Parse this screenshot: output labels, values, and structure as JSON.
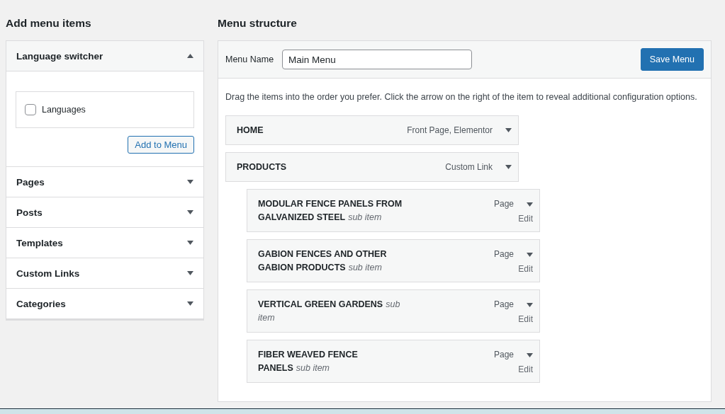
{
  "add_menu_items": {
    "heading": "Add menu items",
    "sections": [
      {
        "title": "Language switcher",
        "expanded": true,
        "options": [
          {
            "label": "Languages",
            "checked": false
          }
        ],
        "button": "Add to Menu"
      },
      {
        "title": "Pages",
        "expanded": false
      },
      {
        "title": "Posts",
        "expanded": false
      },
      {
        "title": "Templates",
        "expanded": false
      },
      {
        "title": "Custom Links",
        "expanded": false
      },
      {
        "title": "Categories",
        "expanded": false
      }
    ]
  },
  "menu_structure": {
    "heading": "Menu structure",
    "menu_name_label": "Menu Name",
    "menu_name_value": "Main Menu",
    "save_button": "Save Menu",
    "instructions": "Drag the items into the order you prefer. Click the arrow on the right of the item to reveal additional configuration options.",
    "items": [
      {
        "title": "HOME",
        "type": "Front Page, Elementor"
      },
      {
        "title": "PRODUCTS",
        "type": "Custom Link",
        "children": [
          {
            "title": "MODULAR FENCE PANELS FROM GALVANIZED STEEL",
            "note": "sub item",
            "type": "Page",
            "edit": "Edit"
          },
          {
            "title": "GABION FENCES AND OTHER GABION PRODUCTS",
            "note": "sub item",
            "type": "Page",
            "edit": "Edit"
          },
          {
            "title": "VERTICAL GREEN GARDENS",
            "note": "sub item",
            "type": "Page",
            "edit": "Edit"
          },
          {
            "title": "FIBER WEAVED FENCE PANELS",
            "note": "sub item",
            "type": "Page",
            "edit": "Edit"
          }
        ]
      }
    ]
  }
}
